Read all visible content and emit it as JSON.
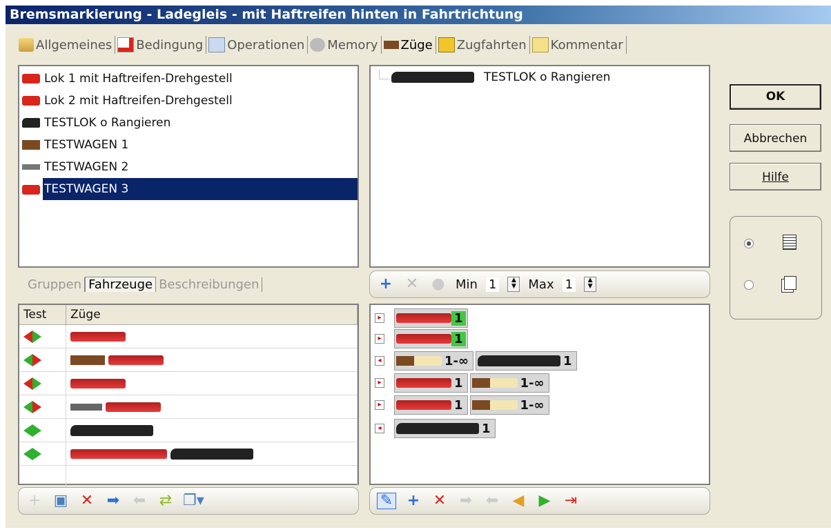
{
  "window": {
    "title": "Bremsmarkierung - Ladegleis - mit Haftreifen hinten in Fahrtrichtung"
  },
  "tabs": [
    {
      "label": "Allgemeines",
      "icon": "general-icon"
    },
    {
      "label": "Bedingung",
      "icon": "condition-icon"
    },
    {
      "label": "Operationen",
      "icon": "operations-icon"
    },
    {
      "label": "Memory",
      "icon": "memory-icon"
    },
    {
      "label": "Züge",
      "icon": "trains-icon",
      "active": true
    },
    {
      "label": "Zugfahrten",
      "icon": "train-runs-icon"
    },
    {
      "label": "Kommentar",
      "icon": "comment-icon"
    }
  ],
  "vehicle_list": [
    {
      "label": "Lok 1 mit Haftreifen-Drehgestell",
      "color": "#d8261c"
    },
    {
      "label": "Lok 2 mit Haftreifen-Drehgestell",
      "color": "#d8261c"
    },
    {
      "label": "TESTLOK o Rangieren",
      "color": "#222222"
    },
    {
      "label": "TESTWAGEN 1",
      "color": "#7b4a22"
    },
    {
      "label": "TESTWAGEN 2",
      "color": "#666666"
    },
    {
      "label": "TESTWAGEN 3",
      "color": "#d8261c",
      "selected": true
    }
  ],
  "tree_panel": {
    "item": "TESTLOK o Rangieren"
  },
  "sub_tabs": [
    "Gruppen",
    "Fahrzeuge",
    "Beschreibungen"
  ],
  "grid": {
    "col_test": "Test",
    "col_trains": "Züge"
  },
  "minmax": {
    "min_label": "Min",
    "min_value": "1",
    "max_label": "Max",
    "max_value": "1"
  },
  "train_rows": [
    {
      "chips": [
        {
          "count": "1",
          "green": true
        }
      ]
    },
    {
      "chips": [
        {
          "count": "1",
          "green": true
        }
      ]
    },
    {
      "chips": [
        {
          "count": "1-∞"
        },
        {
          "count": "1"
        }
      ]
    },
    {
      "chips": [
        {
          "count": "1"
        },
        {
          "count": "1-∞"
        }
      ]
    },
    {
      "chips": [
        {
          "count": "1"
        },
        {
          "count": "1-∞"
        }
      ]
    },
    {
      "chips": [
        {
          "count": "1"
        }
      ]
    }
  ],
  "buttons": {
    "ok": "OK",
    "cancel": "Abbrechen",
    "help": "Hilfe"
  }
}
